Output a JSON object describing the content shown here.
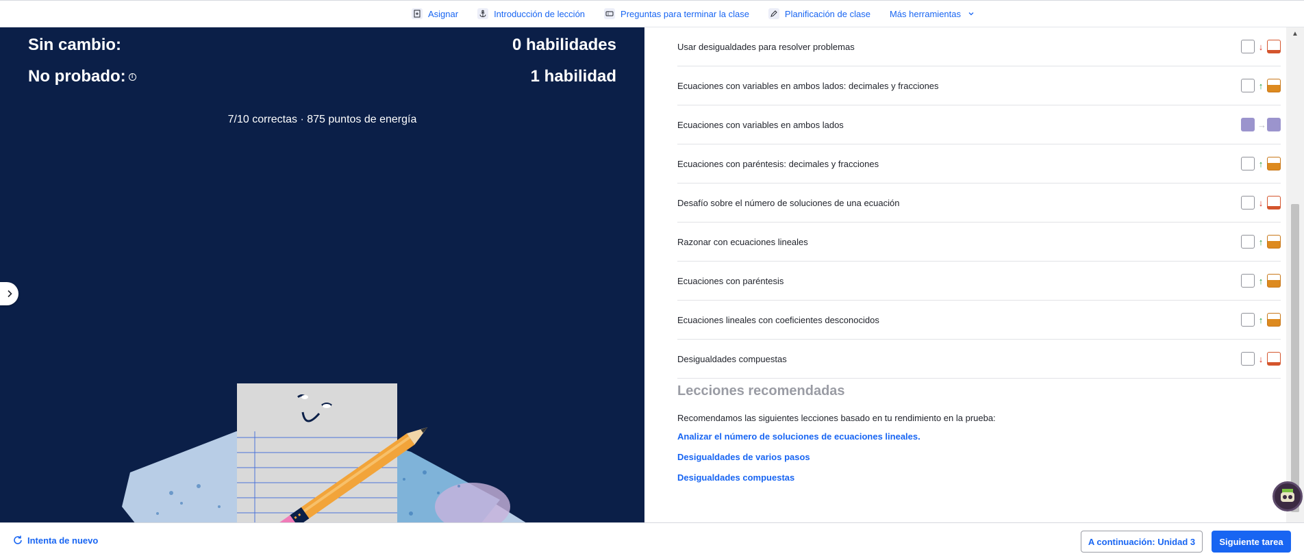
{
  "toolbar": {
    "items": [
      {
        "label": "Asignar",
        "icon": "assign-icon"
      },
      {
        "label": "Introducción de lección",
        "icon": "anchor-icon"
      },
      {
        "label": "Preguntas para terminar la clase",
        "icon": "ticket-icon"
      },
      {
        "label": "Planificación de clase",
        "icon": "pencil-icon"
      }
    ],
    "more_label": "Más herramientas"
  },
  "results": {
    "no_change_label": "Sin cambio:",
    "no_change_value": "0 habilidades",
    "not_tested_label": "No probado:",
    "not_tested_value": "1 habilidad",
    "summary": "7/10 correctas · 875 puntos de energía"
  },
  "skills": [
    {
      "name": "Usar desigualdades para resolver problemas",
      "change": "down",
      "level": "low"
    },
    {
      "name": "Ecuaciones con variables en ambos lados: decimales y fracciones",
      "change": "up",
      "level": "half"
    },
    {
      "name": "Ecuaciones con variables en ambos lados",
      "change": "flat",
      "level": "mastered"
    },
    {
      "name": "Ecuaciones con paréntesis: decimales y fracciones",
      "change": "up",
      "level": "half"
    },
    {
      "name": "Desafío sobre el número de soluciones de una ecuación",
      "change": "down",
      "level": "low"
    },
    {
      "name": "Razonar con ecuaciones lineales",
      "change": "up",
      "level": "half"
    },
    {
      "name": "Ecuaciones con paréntesis",
      "change": "up",
      "level": "half"
    },
    {
      "name": "Ecuaciones lineales con coeficientes desconocidos",
      "change": "up",
      "level": "half"
    },
    {
      "name": "Desigualdades compuestas",
      "change": "down",
      "level": "low"
    }
  ],
  "recommended": {
    "title": "Lecciones recomendadas",
    "description": "Recomendamos las siguientes lecciones basado en tu rendimiento en la prueba:",
    "links": [
      "Analizar el número de soluciones de ecuaciones lineales.",
      "Desigualdades de varios pasos",
      "Desigualdades compuestas"
    ]
  },
  "footer": {
    "retry_label": "Intenta de nuevo",
    "next_unit_label": "A continuación: Unidad 3",
    "next_task_label": "Siguiente tarea"
  },
  "colors": {
    "panel_bg": "#0b1f48",
    "link": "#1865f2",
    "mastered": "#9b94cd",
    "progress_orange": "#dd8a1f",
    "down_red": "#d92916",
    "up_green": "#1f9a3a"
  }
}
